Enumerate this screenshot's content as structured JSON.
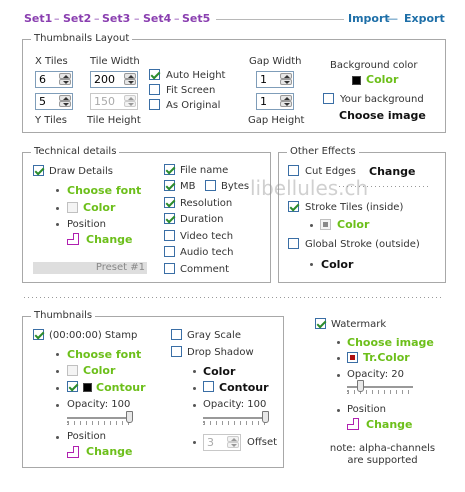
{
  "topbar": {
    "sets": [
      "Set1",
      "Set2",
      "Set3",
      "Set4",
      "Set5"
    ],
    "import_label": "Import",
    "export_label": "Export"
  },
  "layout": {
    "legend": "Thumbnails Layout",
    "x_tiles_label": "X Tiles",
    "x_tiles_value": "6",
    "y_tiles_label": "Y Tiles",
    "y_tiles_value": "5",
    "tile_width_label": "Tile Width",
    "tile_width_value": "200",
    "tile_height_label": "Tile Height",
    "tile_height_value": "150",
    "auto_height_label": "Auto Height",
    "fit_screen_label": "Fit Screen",
    "as_original_label": "As Original",
    "gap_width_label": "Gap Width",
    "gap_width_value": "1",
    "gap_height_label": "Gap Height",
    "gap_height_value": "1",
    "bg_color_label": "Background color",
    "color_label": "Color",
    "your_bg_label": "Your background",
    "choose_image_label": "Choose image"
  },
  "technical": {
    "legend": "Technical details",
    "draw_details_label": "Draw Details",
    "choose_font_label": "Choose font",
    "color_label": "Color",
    "position_label": "Position",
    "change_label": "Change",
    "preset_label": "Preset #1",
    "items": [
      "File name",
      "MB",
      "Bytes",
      "Resolution",
      "Duration",
      "Video tech",
      "Audio tech",
      "Comment"
    ]
  },
  "effects": {
    "legend": "Other Effects",
    "cut_edges_label": "Cut Edges",
    "change_label": "Change",
    "stroke_tiles_label": "Stroke Tiles (inside)",
    "color_label": "Color",
    "global_stroke_label": "Global Stroke (outside)",
    "color2_label": "Color"
  },
  "watermark_logo": "libellules.ch",
  "thumbnails": {
    "legend": "Thumbnails",
    "stamp_label": "(00:00:00) Stamp",
    "choose_font_label": "Choose font",
    "color_label": "Color",
    "contour_label": "Contour",
    "opacity_label": "Opacity: 100",
    "position_label": "Position",
    "change_label": "Change",
    "gray_scale_label": "Gray Scale",
    "drop_shadow_label": "Drop Shadow",
    "shadow_color_label": "Color",
    "shadow_contour_label": "Contour",
    "shadow_opacity_label": "Opacity: 100",
    "offset_value": "3",
    "offset_label": "Offset"
  },
  "watermark": {
    "label": "Watermark",
    "choose_image_label": "Choose image",
    "tr_color_label": "Tr.Color",
    "opacity_label": "Opacity: 20",
    "position_label": "Position",
    "change_label": "Change",
    "note_line1": "note: alpha-channels",
    "note_line2": "are supported"
  },
  "colors": {
    "set_purple": "#8a3fb0",
    "action_blue": "#1e6fa8",
    "green": "#6cbf1a",
    "magenta": "#b020b0",
    "tr_red": "#b01010"
  }
}
